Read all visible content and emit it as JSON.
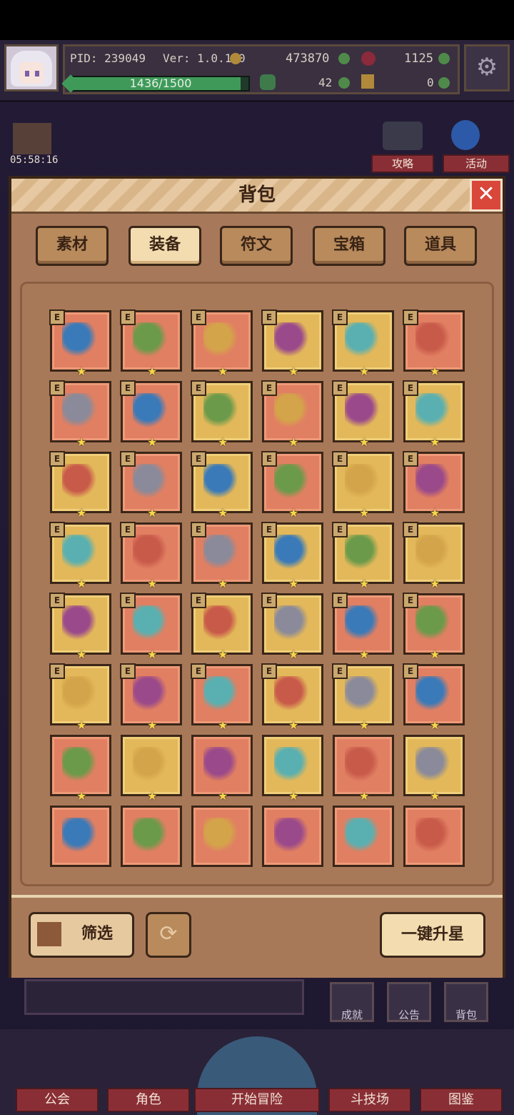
{
  "hud": {
    "pid": "PID: 239049",
    "version": "Ver: 1.0.1.0",
    "gold": "473870",
    "gems": "1125",
    "xp": "1436/1500",
    "xp_fraction": 0.957,
    "clover": "42",
    "keys": "0"
  },
  "timer": "05:58:16",
  "side_buttons": {
    "guide": "攻略",
    "event": "活动"
  },
  "modal": {
    "title": "背包",
    "tabs": [
      "素材",
      "装备",
      "符文",
      "宝箱",
      "道具"
    ],
    "active_tab": "装备",
    "badge_letter": "E",
    "filter_label": "筛选",
    "upgrade_label": "一键升星"
  },
  "colors": {
    "gold_cell": "#e3b85a",
    "red_cell": "#e17f62",
    "frame": "#3a2618"
  },
  "items": [
    [
      "red",
      "hat-icon",
      1
    ],
    [
      "red",
      "pot-icon",
      1
    ],
    [
      "red",
      "helmet-icon",
      1
    ],
    [
      "gold",
      "staff-icon",
      1
    ],
    [
      "gold",
      "scepter-icon",
      1
    ],
    [
      "red",
      "bow-icon",
      1
    ],
    [
      "red",
      "wand-icon",
      1
    ],
    [
      "red",
      "teddy-bear-icon",
      1
    ],
    [
      "gold",
      "orb-icon",
      1
    ],
    [
      "red",
      "arrow-icon",
      1
    ],
    [
      "gold",
      "crossbow-icon",
      1
    ],
    [
      "gold",
      "wizard-hat-icon",
      1
    ],
    [
      "gold",
      "hood-icon",
      1
    ],
    [
      "red",
      "cap-icon",
      1
    ],
    [
      "gold",
      "robe-icon",
      1
    ],
    [
      "red",
      "dress-icon",
      1
    ],
    [
      "gold",
      "cape-icon",
      1
    ],
    [
      "red",
      "vest-icon",
      1
    ],
    [
      "gold",
      "boot-icon",
      1
    ],
    [
      "red",
      "scroll-icon",
      1
    ],
    [
      "red",
      "boot-icon",
      1
    ],
    [
      "gold",
      "ring-icon",
      1
    ],
    [
      "gold",
      "crown-icon",
      1
    ],
    [
      "gold",
      "gauntlet-icon",
      1
    ],
    [
      "gold",
      "boots-icon",
      1
    ],
    [
      "red",
      "shoes-icon",
      1
    ],
    [
      "gold",
      "leaf-icon",
      1
    ],
    [
      "gold",
      "amulet-icon",
      1
    ],
    [
      "red",
      "flower-icon",
      1
    ],
    [
      "red",
      "heart-necklace-icon",
      1
    ],
    [
      "gold",
      "necklace-icon",
      1
    ],
    [
      "red",
      "collar-icon",
      1
    ],
    [
      "red",
      "pendant-icon",
      1
    ],
    [
      "gold",
      "medal-icon",
      1
    ],
    [
      "gold",
      "relic-icon",
      1
    ],
    [
      "red",
      "swords-icon",
      1
    ],
    [
      "red",
      "axe-icon",
      1
    ],
    [
      "gold",
      "crossbow-icon",
      1
    ],
    [
      "red",
      "stick-icon",
      1
    ],
    [
      "gold",
      "club-icon",
      1
    ],
    [
      "red",
      "sword-icon",
      1
    ],
    [
      "gold",
      "bow-icon",
      1
    ],
    [
      "red",
      "crossbow-icon",
      0
    ],
    [
      "red",
      "dagger-icon",
      0
    ],
    [
      "red",
      "spear-icon",
      0
    ],
    [
      "red",
      "sword-icon",
      0
    ],
    [
      "red",
      "dagger-icon",
      0
    ],
    [
      "red",
      "wand-icon",
      0
    ]
  ],
  "nav": [
    "公会",
    "角色",
    "开始冒险",
    "斗技场",
    "图鉴"
  ],
  "bg_buttons": [
    "成就",
    "公告",
    "背包"
  ]
}
